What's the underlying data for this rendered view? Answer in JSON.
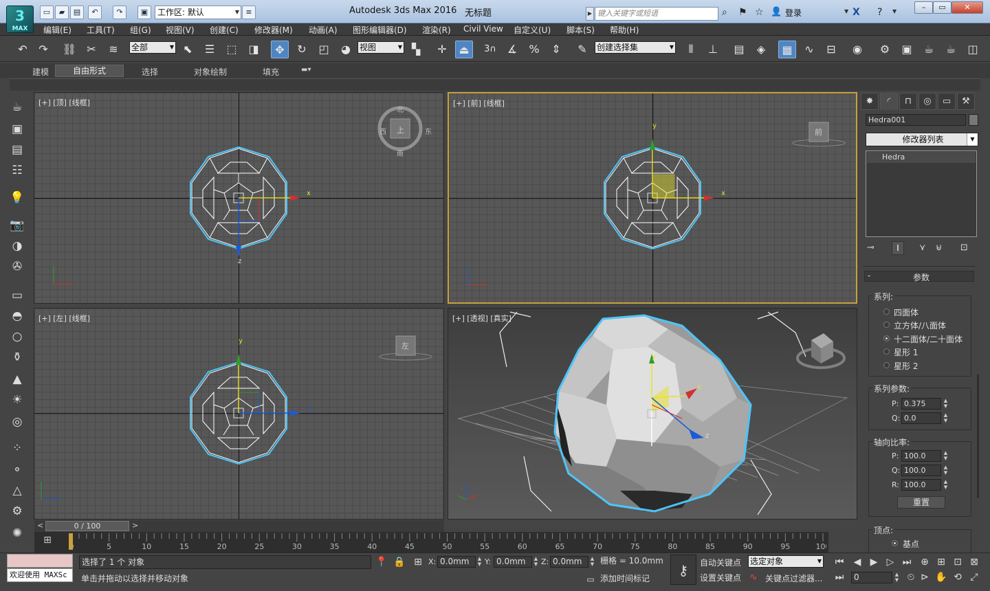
{
  "titlebar": {
    "app_title": "Autodesk 3ds Max 2016",
    "doc_title": "无标题",
    "workspace": "工作区: 默认",
    "search_placeholder": "键入关键字或短语",
    "login": "登录",
    "logo_label": "MAX"
  },
  "menu": [
    "编辑(E)",
    "工具(T)",
    "组(G)",
    "视图(V)",
    "创建(C)",
    "修改器(M)",
    "动画(A)",
    "图形编辑器(D)",
    "渲染(R)",
    "Civil View",
    "自定义(U)",
    "脚本(S)",
    "帮助(H)"
  ],
  "toolbar": {
    "filter": "全部",
    "refcoord": "视图",
    "selset": "创建选择集",
    "snap_num": "3"
  },
  "ribbon": {
    "tabs": [
      "建模",
      "自由形式",
      "选择",
      "对象绘制",
      "填充"
    ]
  },
  "viewports": {
    "top": "[+] [顶] [线框]",
    "front": "[+] [前] [线框]",
    "left": "[+] [左] [线框]",
    "persp": "[+] [透视] [真实]"
  },
  "viewcube": {
    "top_north": "北",
    "top_south": "南",
    "top_west": "西",
    "top_east": "东",
    "top_face": "上",
    "front_face": "前",
    "left_face": "左"
  },
  "axes": {
    "x": "x",
    "y": "y",
    "z": "z"
  },
  "timeline": {
    "slider": "0 / 100",
    "ticks": [
      "0",
      "5",
      "10",
      "15",
      "20",
      "25",
      "30",
      "35",
      "40",
      "45",
      "50",
      "55",
      "60",
      "65",
      "70",
      "75",
      "80",
      "85",
      "90",
      "95",
      "100"
    ]
  },
  "command_panel": {
    "object_name": "Hedra001",
    "modifier_list": "修改器列表",
    "stack_item": "Hedra",
    "rollout_title": "参数",
    "family_title": "系列:",
    "families": [
      "四面体",
      "立方体/八面体",
      "十二面体/二十面体",
      "星形 1",
      "星形 2"
    ],
    "family_selected": 2,
    "family_params_title": "系列参数:",
    "p_label": "P:",
    "p_value": "0.375",
    "q_label": "Q:",
    "q_value": "0.0",
    "axis_title": "轴向比率:",
    "ap_label": "P:",
    "ap_value": "100.0",
    "aq_label": "Q:",
    "aq_value": "100.0",
    "ar_label": "R:",
    "ar_value": "100.0",
    "reset": "重置",
    "vertex_title": "顶点:",
    "vertex_option": "基点"
  },
  "status": {
    "maxscript": "欢迎使用 MAXSc",
    "selection": "选择了 1 个 对象",
    "prompt": "单击并拖动以选择并移动对象",
    "x_label": "X:",
    "x_value": "0.0mm",
    "y_label": "Y:",
    "y_value": "0.0mm",
    "z_label": "Z:",
    "z_value": "0.0mm",
    "grid": "栅格 = 10.0mm",
    "add_time_tag": "添加时间标记",
    "auto_key": "自动关键点",
    "set_key": "设置关键点",
    "key_mode": "选定对象",
    "key_filters": "关键点过滤器...",
    "frame": "0"
  },
  "colors": {
    "selection_outline": "#4fc3f7",
    "active_border": "#c9a13d",
    "axis_x": "#d32f2f",
    "axis_y": "#2e9d2e",
    "axis_z": "#1e5ad8",
    "gizmo_yellow": "#e8e02a"
  }
}
